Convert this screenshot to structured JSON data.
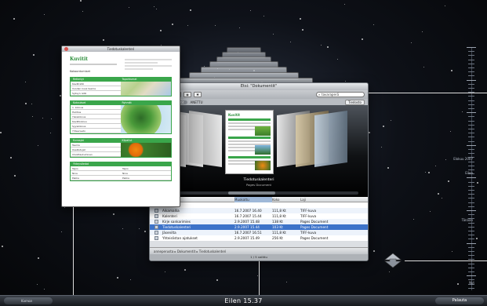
{
  "bottom_bar": {
    "cancel_label": "Kumoa",
    "time_label": "Eilen 15.37",
    "restore_label": "Palauta"
  },
  "finder": {
    "title": "Etsi: \"Dokumentit\"",
    "search_value": "tavaraperä",
    "path_label_1": "Mac",
    "path_pill": "Dokumentit",
    "path_label_2": "ANETTU",
    "sort_select": "Tiedosto",
    "coverflow_caption": "Tiedotuskalenteri",
    "coverflow_subcaption": "Pages Document",
    "columns": [
      "Nimi",
      "Muokattu",
      "Koko",
      "Laji"
    ],
    "rows": [
      {
        "name": "Asiakirjat",
        "date": "",
        "size": "",
        "kind": "",
        "selected": false
      },
      {
        "name": "Aikamallia",
        "date": "16.7.2007 16.40",
        "size": "111,8 Kt",
        "kind": "TIFF-kuva",
        "selected": false
      },
      {
        "name": "Kalenteri",
        "date": "16.7.2007 15.44",
        "size": "111,8 Kt",
        "kind": "TIFF-kuva",
        "selected": false
      },
      {
        "name": "Kirje sankarimies",
        "date": "2.9.2007 15.48",
        "size": "138 Kt",
        "kind": "Pages Document",
        "selected": false
      },
      {
        "name": "Tiedotuskalenteri",
        "date": "2.9.2007 15.44",
        "size": "103 Kt",
        "kind": "Pages Document",
        "selected": true
      },
      {
        "name": "Jäsenilta",
        "date": "16.7.2007 16.51",
        "size": "111,8 Kt",
        "kind": "TIFF-kuva",
        "selected": false
      },
      {
        "name": "Yhteislistan ajatukset",
        "date": "2.9.2007 15.49",
        "size": "256 Kt",
        "kind": "Pages Document",
        "selected": false
      }
    ],
    "status_path": "anneperusta  ▸  Dokumentit  ▸  Tiedotuskalenteri",
    "bottom_status": "1 / 5 valittu"
  },
  "quicklook": {
    "title": "Tiedotuskalenteri",
    "logo": "Kuvitit",
    "subtitle": "Kokoontumiset",
    "sections": [
      {
        "left_head": "Retkeilyt",
        "right_head": "Tapahtumat",
        "rows": [
          "Kevätretki",
          "Vuoden kuva teema",
          "Syksyn retki"
        ],
        "image": "map"
      },
      {
        "left_head": "Kokoukset",
        "right_head": "Ryhmät",
        "rows": [
          "1. kokous",
          "Hallitus",
          "Yleiskokous",
          "Kevätkokous",
          "Syyskokous",
          "Yhteenveto"
        ],
        "image": "tree"
      },
      {
        "left_head": "Kuvaajat",
        "right_head": "Kilpailut",
        "rows": [
          "Teema",
          "Osallistujat",
          "Ilmoittautuminen"
        ],
        "image": "flower"
      },
      {
        "left_head": "Yhteystiedot",
        "right_head": "",
        "rows": [
          "Tapio",
          "Nina",
          "Pekka"
        ],
        "image": ""
      }
    ]
  },
  "timeline": {
    "labels": [
      "Elokuu 2007",
      "Eilen",
      "Tänään",
      "Nyt"
    ]
  },
  "colors": {
    "accent_green": "#3aa64b",
    "selection_blue": "#3d73c9"
  }
}
